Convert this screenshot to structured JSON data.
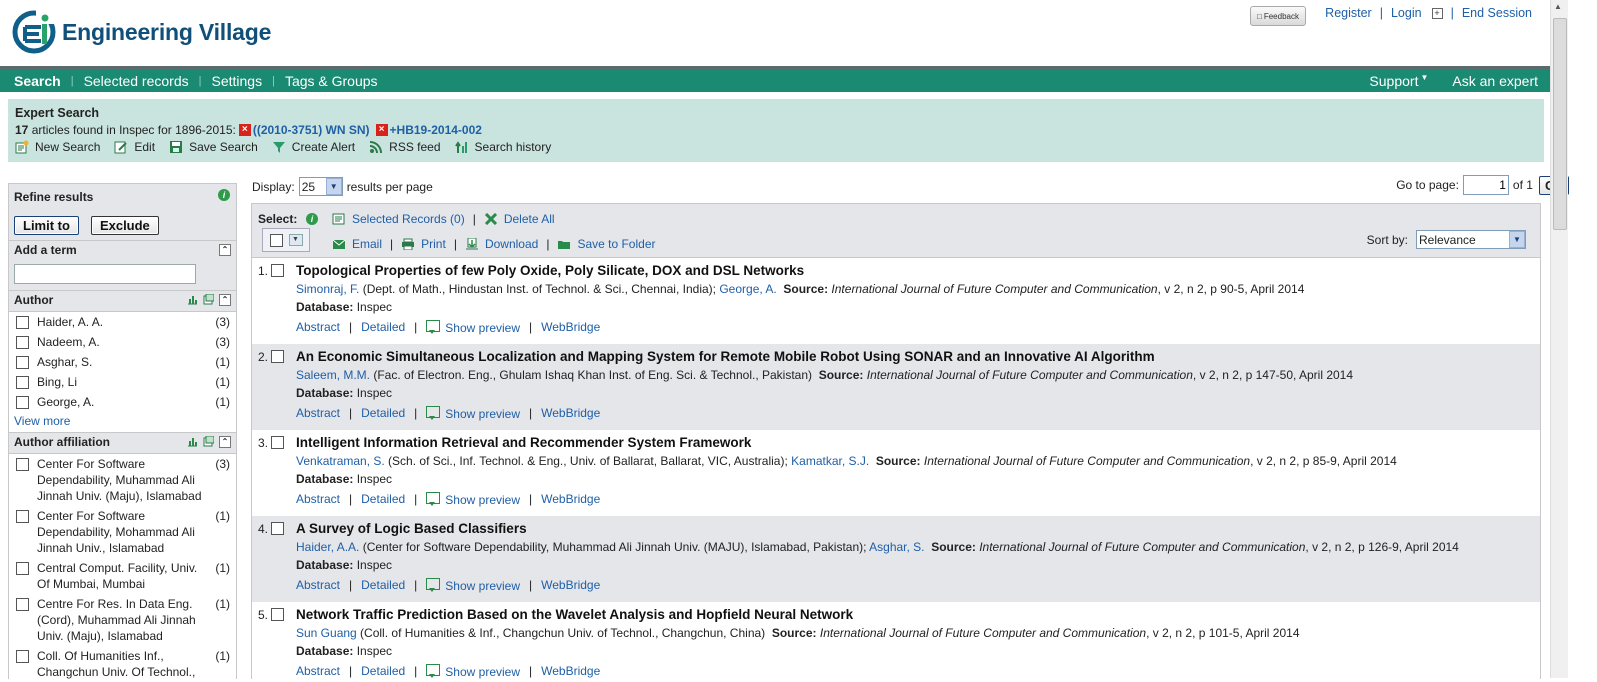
{
  "app": {
    "logo_text": "Engineering Village",
    "brand_color": "#1a8a72"
  },
  "header": {
    "feedback_label": "Feedback",
    "register": "Register",
    "login": "Login",
    "end_session": "End Session"
  },
  "nav": {
    "items": [
      "Search",
      "Selected records",
      "Settings",
      "Tags & Groups"
    ],
    "support": "Support",
    "ask_expert": "Ask an expert"
  },
  "search": {
    "title": "Expert Search",
    "count": "17",
    "found_text": " articles found in Inspec for 1896-2015:",
    "term1": "((2010-3751) WN SN)",
    "plus": "+",
    "term2": "HB19-2014-002",
    "actions": [
      "New Search",
      "Edit",
      "Save Search",
      "Create Alert",
      "RSS feed",
      "Search history"
    ]
  },
  "refine": {
    "title": "Refine results",
    "limit_to": "Limit to",
    "exclude": "Exclude",
    "add_term": "Add a term",
    "author": {
      "title": "Author",
      "items": [
        {
          "label": "Haider, A. A.",
          "count": "(3)"
        },
        {
          "label": "Nadeem, A.",
          "count": "(3)"
        },
        {
          "label": "Asghar, S.",
          "count": "(1)"
        },
        {
          "label": "Bing, Li",
          "count": "(1)"
        },
        {
          "label": "George, A.",
          "count": "(1)"
        }
      ],
      "view_more": "View more"
    },
    "affiliation": {
      "title": "Author affiliation",
      "items": [
        {
          "label": "Center For Software Dependability, Muhammad Ali Jinnah Univ. (Maju), Islamabad",
          "count": "(3)"
        },
        {
          "label": "Center For Software Dependability, Mohammad Ali Jinnah Univ., Islamabad",
          "count": "(1)"
        },
        {
          "label": "Central Comput. Facility, Univ. Of Mumbai, Mumbai",
          "count": "(1)"
        },
        {
          "label": "Centre For Res. In Data Eng. (Cord), Muhammad Ali Jinnah Univ. (Maju), Islamabad",
          "count": "(1)"
        },
        {
          "label": "Coll. Of Humanities Inf., Changchun Univ. Of Technol.,",
          "count": "(1)"
        }
      ]
    }
  },
  "display": {
    "label": "Display:",
    "per_page": "25",
    "suffix": "results per page",
    "goto_label": "Go to page:",
    "page": "1",
    "of": "of 1",
    "go": "Go"
  },
  "toolbar": {
    "select_label": "Select:",
    "selected_records": "Selected Records (0)",
    "delete_all": "Delete All",
    "email": "Email",
    "print": "Print",
    "download": "Download",
    "save_folder": "Save to Folder",
    "sort_label": "Sort by:",
    "sort_value": "Relevance"
  },
  "record_links": {
    "abstract": "Abstract",
    "detailed": "Detailed",
    "preview": "Show preview",
    "webbridge": "WebBridge",
    "database_label": "Database:",
    "source_label": "Source:"
  },
  "records": [
    {
      "num": "1.",
      "title": "Topological Properties of few Poly Oxide, Poly Silicate, DOX and DSL Networks",
      "author1": "Simonraj, F.",
      "aff1": " (Dept. of Math., Hindustan Inst. of Technol. & Sci., Chennai, India);",
      "author2": "George, A.",
      "journal": "International Journal of Future Computer and Communication",
      "details": ", v 2, n 2, p 90-5, April 2014",
      "database": "Inspec"
    },
    {
      "num": "2.",
      "title": "An Economic Simultaneous Localization and Mapping System for Remote Mobile Robot Using SONAR and an Innovative AI Algorithm",
      "author1": "Saleem, M.M.",
      "aff1": " (Fac. of Electron. Eng., Ghulam Ishaq Khan Inst. of Eng. Sci. & Technol., Pakistan)",
      "author2": "",
      "journal": "International Journal of Future Computer and Communication",
      "details": ", v 2, n 2, p 147-50, April 2014",
      "database": "Inspec"
    },
    {
      "num": "3.",
      "title": "Intelligent Information Retrieval and Recommender System Framework",
      "author1": "Venkatraman, S.",
      "aff1": " (Sch. of Sci., Inf. Technol. & Eng., Univ. of Ballarat, Ballarat, VIC, Australia);",
      "author2": "Kamatkar, S.J.",
      "journal": "International Journal of Future Computer and Communication",
      "details": ", v 2, n 2, p 85-9, April 2014",
      "database": "Inspec"
    },
    {
      "num": "4.",
      "title": "A Survey of Logic Based Classifiers",
      "author1": "Haider, A.A.",
      "aff1": " (Center for Software Dependability, Muhammad Ali Jinnah Univ. (MAJU), Islamabad, Pakistan);",
      "author2": "Asghar, S.",
      "journal": "International Journal of Future Computer and Communication",
      "details": ", v 2, n 2, p 126-9, April 2014",
      "database": "Inspec"
    },
    {
      "num": "5.",
      "title": "Network Traffic Prediction Based on the Wavelet Analysis and Hopfield Neural Network",
      "author1": "Sun Guang",
      "aff1": " (Coll. of Humanities & Inf., Changchun Univ. of Technol., Changchun, China)",
      "author2": "",
      "journal": "International Journal of Future Computer and Communication",
      "details": ", v 2, n 2, p 101-5, April 2014",
      "database": "Inspec"
    }
  ]
}
